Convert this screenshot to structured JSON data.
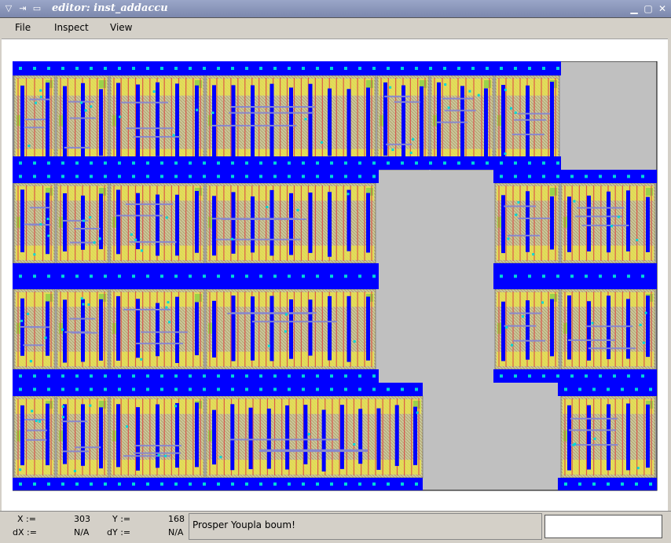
{
  "window": {
    "title": "editor: inst_addaccu"
  },
  "menu": {
    "file": "File",
    "inspect": "Inspect",
    "view": "View"
  },
  "status": {
    "x_label": "X :=",
    "x_value": "303",
    "y_label": "Y :=",
    "y_value": "168",
    "dx_label": "dX :=",
    "dx_value": "N/A",
    "dy_label": "dY :=",
    "dy_value": "N/A",
    "message": "Prosper Youpla boum!",
    "input_value": ""
  },
  "colors": {
    "rail": "#0000ff",
    "empty": "#c0c0c0",
    "cell": "#c8c89a",
    "poly": "#dd4444",
    "metal2": "#8888cc",
    "diff": "#9ad24a",
    "via": "#00d8d8",
    "yellow": "#e6e050"
  }
}
